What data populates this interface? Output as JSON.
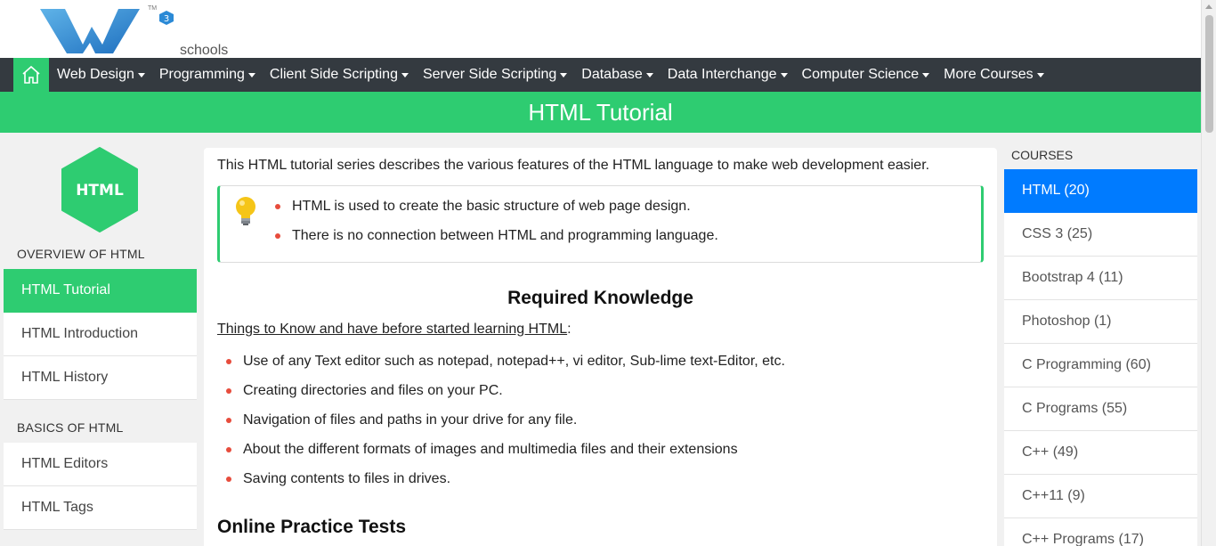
{
  "logo": {
    "text": "schools",
    "tm": "TM",
    "badge": "3"
  },
  "nav": {
    "home_icon": "home-icon",
    "items": [
      "Web Design",
      "Programming",
      "Client Side Scripting",
      "Server Side Scripting",
      "Database",
      "Data Interchange",
      "Computer Science",
      "More Courses"
    ]
  },
  "banner": {
    "title": "HTML Tutorial"
  },
  "left": {
    "logo_text": "HTML",
    "sections": [
      {
        "title": "OVERVIEW OF HTML",
        "items": [
          "HTML Tutorial",
          "HTML Introduction",
          "HTML History"
        ]
      },
      {
        "title": "BASICS OF HTML",
        "items": [
          "HTML Editors",
          "HTML Tags"
        ]
      }
    ]
  },
  "main": {
    "intro": "This HTML tutorial series describes the various features of the HTML language to make web development easier.",
    "tips": [
      "HTML is used to create the basic structure of web page design.",
      "There is no connection between HTML and programming language."
    ],
    "required_heading": "Required Knowledge",
    "things_link": "Things to Know and have before started learning HTML",
    "things_suffix": ":",
    "requirements": [
      "Use of any Text editor such as notepad, notepad++, vi editor, Sub-lime text-Editor, etc.",
      "Creating directories and files on your PC.",
      "Navigation of files and paths in your drive for any file.",
      "About the different formats of images and multimedia files and their extensions",
      "Saving contents to files in drives."
    ],
    "online_heading": "Online Practice Tests"
  },
  "right": {
    "title": "COURSES",
    "courses": [
      "HTML (20)",
      "CSS 3 (25)",
      "Bootstrap 4 (11)",
      "Photoshop (1)",
      "C Programming (60)",
      "C Programs (55)",
      "C++ (49)",
      "C++11 (9)",
      "C++ Programs (17)"
    ]
  },
  "colors": {
    "brand_green": "#2ecc71",
    "navbar": "#343a40",
    "active_course": "#007bff",
    "bullet": "#e74c3c"
  }
}
